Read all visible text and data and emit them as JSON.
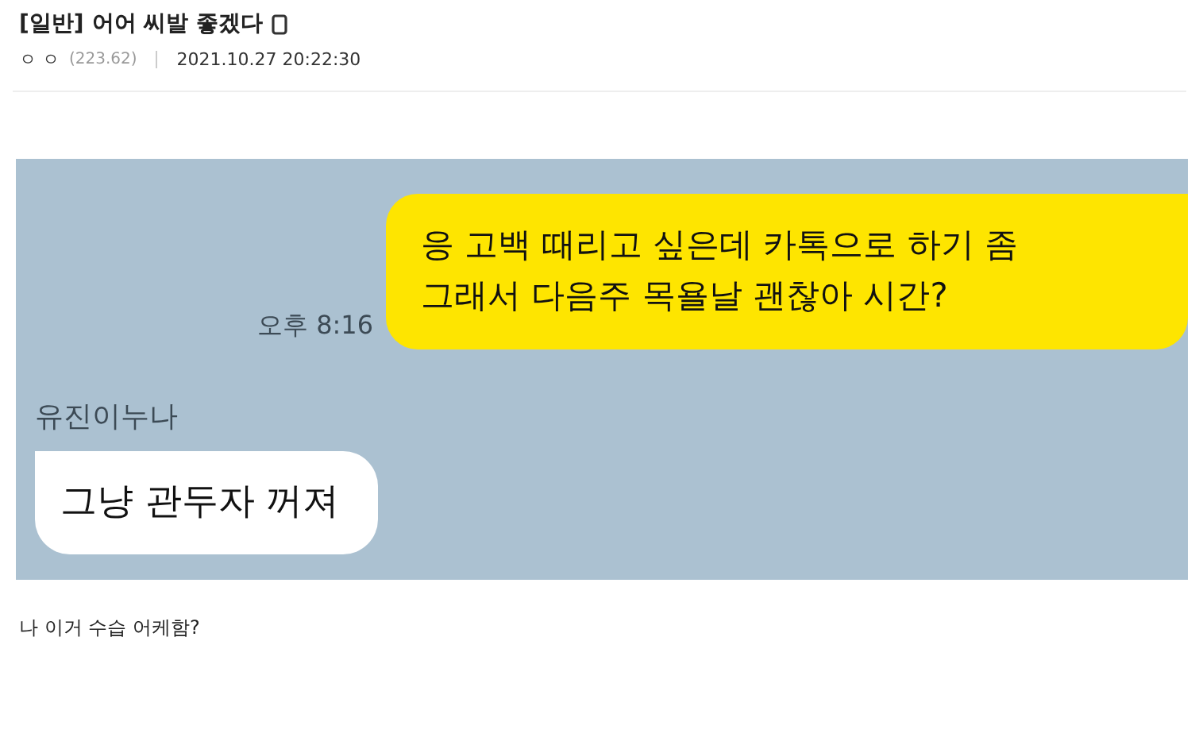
{
  "post": {
    "category": "[일반]",
    "title": "어어 씨발 좋겠다",
    "author": "ㅇ ㅇ",
    "ip": "(223.62)",
    "date": "2021.10.27 20:22:30"
  },
  "chat": {
    "messages": [
      {
        "kind": "sent",
        "lines": [
          "응 고백 때리고 싶은데 카톡으로 하기 좀",
          "그래서 다음주 목욜날 괜찮아 시간?"
        ],
        "time": "오후 8:16"
      },
      {
        "kind": "received",
        "sender": "유진이누나",
        "lines": [
          "그냥 관두자 꺼져"
        ]
      }
    ]
  },
  "body": "나 이거 수습 어케함?"
}
